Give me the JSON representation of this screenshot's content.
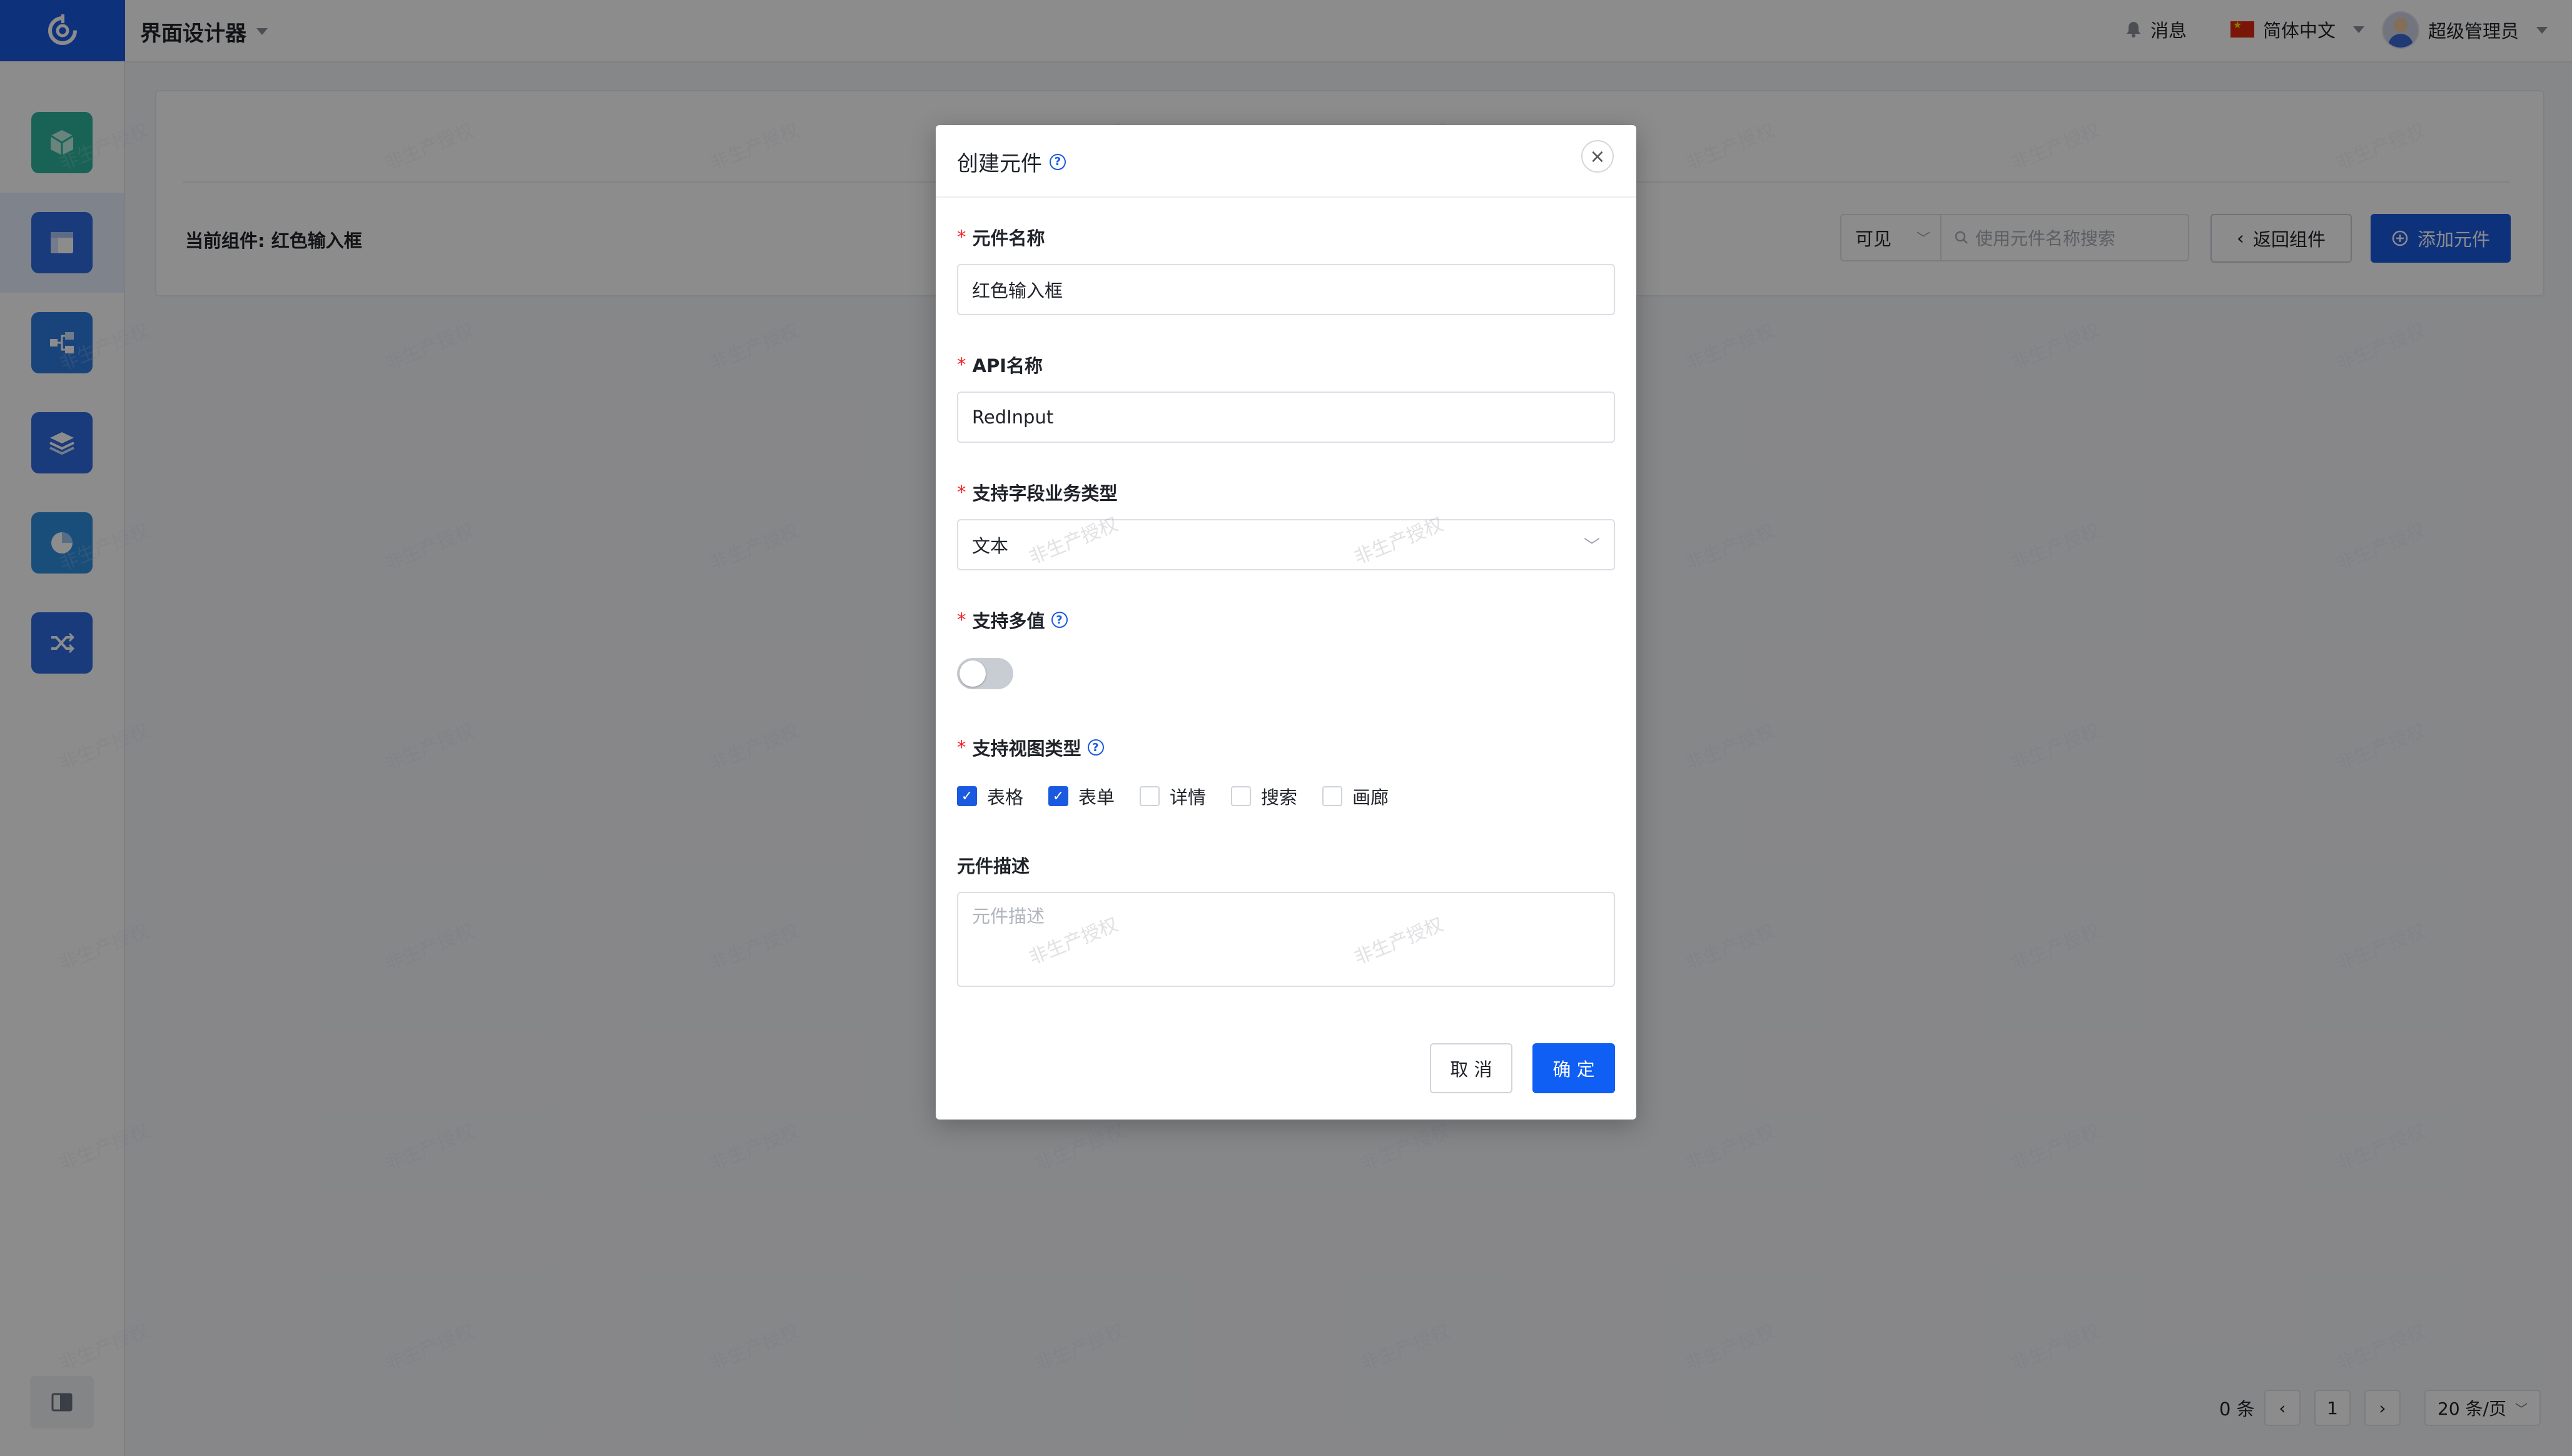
{
  "header": {
    "app_title": "界面设计器",
    "messages_label": "消息",
    "language_label": "简体中文",
    "user_name": "超级管理员"
  },
  "sidebar": {
    "items": [
      {
        "icon": "cube-icon",
        "color": "#2fb59d"
      },
      {
        "icon": "layout-icon",
        "color": "#2f6be0",
        "active": true
      },
      {
        "icon": "flow-icon",
        "color": "#2f7de0"
      },
      {
        "icon": "layers-icon",
        "color": "#2f6be0"
      },
      {
        "icon": "pie-chart-icon",
        "color": "#2f8fe0"
      },
      {
        "icon": "shuffle-icon",
        "color": "#2f6be0"
      }
    ]
  },
  "toolbar": {
    "current_component": "当前组件: 红色输入框",
    "visibility_value": "可见",
    "search_placeholder": "使用元件名称搜索",
    "back_label": "返回组件",
    "add_label": "添加元件"
  },
  "pagination": {
    "total": "0 条",
    "current_page": "1",
    "page_size": "20 条/页"
  },
  "watermark_text": "非生产授权",
  "modal": {
    "title": "创建元件",
    "fields": {
      "name_label": "元件名称",
      "name_value": "红色输入框",
      "api_label": "API名称",
      "api_value": "RedInput",
      "field_type_label": "支持字段业务类型",
      "field_type_value": "文本",
      "multi_label": "支持多值",
      "multi_value": false,
      "view_type_label": "支持视图类型",
      "view_types": [
        {
          "label": "表格",
          "checked": true
        },
        {
          "label": "表单",
          "checked": true
        },
        {
          "label": "详情",
          "checked": false
        },
        {
          "label": "搜索",
          "checked": false
        },
        {
          "label": "画廊",
          "checked": false
        }
      ],
      "desc_label": "元件描述",
      "desc_placeholder": "元件描述"
    },
    "cancel_label": "取 消",
    "ok_label": "确 定"
  },
  "colors": {
    "primary": "#1a5ae0",
    "required": "#f5222d"
  }
}
